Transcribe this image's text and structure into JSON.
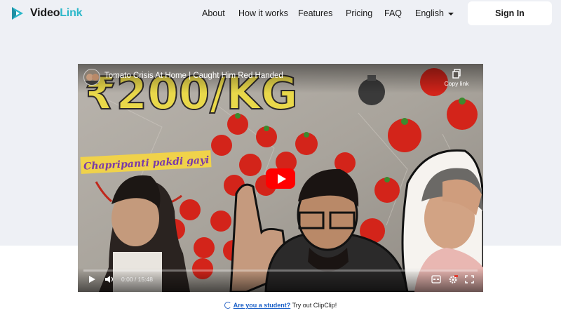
{
  "brand": {
    "name_dark": "Video",
    "name_accent": "Link",
    "accent_color": "#2bb7c9"
  },
  "nav": {
    "items": [
      "About",
      "How it works",
      "Features",
      "Pricing",
      "FAQ"
    ],
    "language": "English",
    "sign_in_label": "Sign In"
  },
  "video": {
    "title": "Tomato Crisis At Home | Caught Him Red Handed",
    "copy_link_label": "Copy link",
    "time_current": "0:00",
    "time_separator": "/",
    "time_total": "15:48",
    "thumbnail_headline": "₹200/KG",
    "thumbnail_caption": "Chapripanti pakdi gayi",
    "play_color": "#ff0000",
    "progress": 0
  },
  "promo": {
    "link_text": "Are you a student?",
    "suffix_text": "Try out ClipClip!"
  },
  "icons": [
    "logo-mark-icon",
    "copy-link-icon",
    "play-icon",
    "volume-icon",
    "captions-icon",
    "settings-icon",
    "fullscreen-icon",
    "clipclip-icon",
    "chevron-down-icon"
  ]
}
